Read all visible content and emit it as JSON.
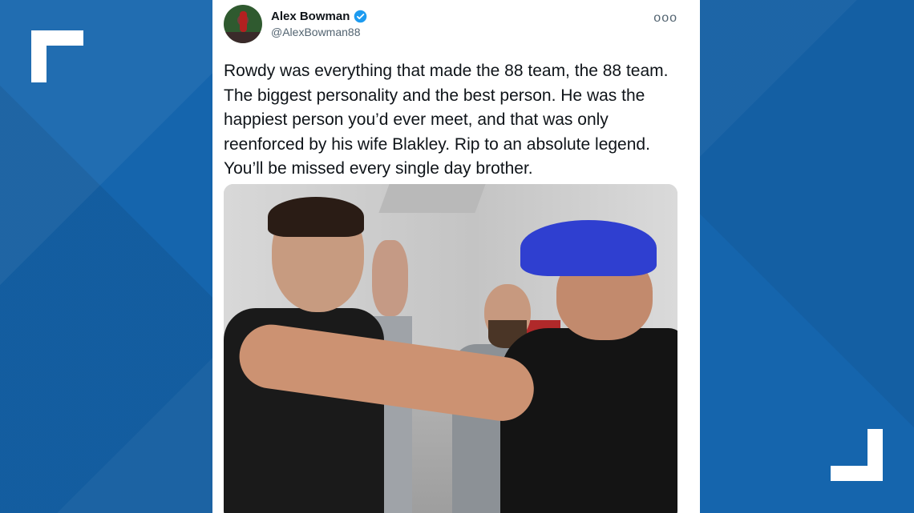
{
  "tweet": {
    "author_name": "Alex Bowman",
    "handle": "@AlexBowman88",
    "more_icon": "ooo",
    "text": "Rowdy was everything that made the 88 team, the 88 team. The biggest personality and the best person. He was the happiest person you’d ever meet, and that was only reenforced by his wife Blakley. Rip to an absolute legend. You’ll be missed every single day brother."
  },
  "colors": {
    "background": "#1565ad",
    "verified": "#1d9bf0",
    "text": "#0f1419",
    "secondary_text": "#536471"
  }
}
